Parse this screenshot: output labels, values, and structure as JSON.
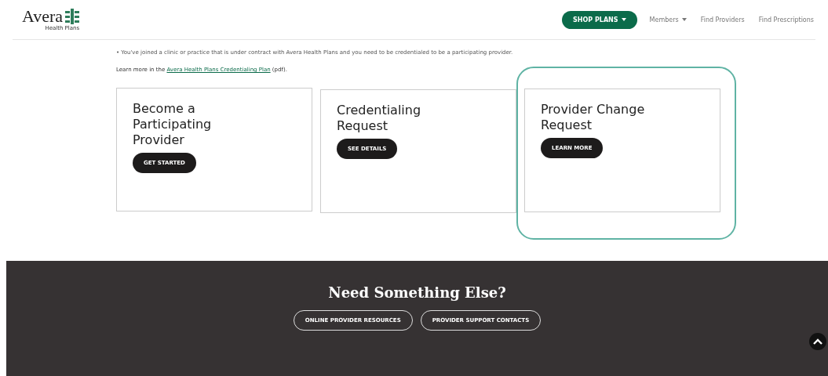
{
  "header": {
    "logo": "Avera",
    "logo_sub": "Health Plans",
    "nav": [
      {
        "label": "SHOP PLANS",
        "kind": "primary",
        "dropdown": true
      },
      {
        "label": "Members",
        "kind": "link",
        "dropdown": true
      },
      {
        "label": "Find Providers",
        "kind": "link",
        "dropdown": false
      },
      {
        "label": "Find Prescriptions",
        "kind": "link",
        "dropdown": false
      }
    ]
  },
  "content": {
    "bullet": "• You've joined a clinic or practice that is under contract with Avera Health Plans and you need to be credentialed to be a participating provider.",
    "learn_prefix": "Learn more in the",
    "learn_link": "Avera Health Plans Credentialing Plan",
    "learn_suffix": "(pdf).",
    "cards": [
      {
        "title": "Become a Participating Provider",
        "button": "GET STARTED",
        "highlighted": false
      },
      {
        "title": "Credentialing Request",
        "button": "SEE DETAILS",
        "highlighted": false
      },
      {
        "title": "Provider Change Request",
        "button": "LEARN MORE",
        "highlighted": true
      }
    ]
  },
  "footer": {
    "heading": "Need Something Else?",
    "buttons": [
      "ONLINE PROVIDER RESOURCES",
      "PROVIDER SUPPORT CONTACTS"
    ]
  }
}
